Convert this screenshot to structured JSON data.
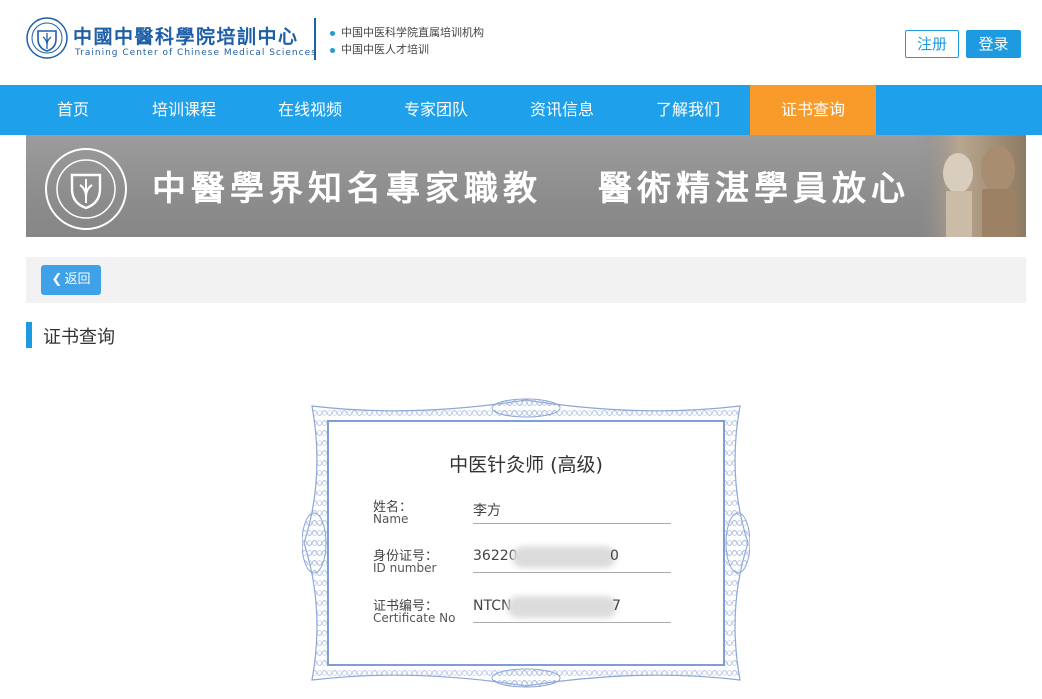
{
  "header": {
    "brand_cn": "中國中醫科學院培訓中心",
    "brand_en": "Training Center of Chinese Medical Sciences",
    "bullets": [
      "中国中医科学院直属培训机构",
      "中国中医人才培训"
    ],
    "register_label": "注册",
    "login_label": "登录"
  },
  "nav": {
    "items": [
      {
        "label": "首页",
        "active": false
      },
      {
        "label": "培训课程",
        "active": false
      },
      {
        "label": "在线视频",
        "active": false
      },
      {
        "label": "专家团队",
        "active": false
      },
      {
        "label": "资讯信息",
        "active": false
      },
      {
        "label": "了解我们",
        "active": false
      },
      {
        "label": "证书查询",
        "active": true
      }
    ]
  },
  "banner": {
    "text1": "中醫學界知名專家職教",
    "text2": "醫術精湛學員放心"
  },
  "back_label": "返回",
  "section_title": "证书查询",
  "certificate": {
    "title": "中医针灸师 (高级)",
    "fields": [
      {
        "label_cn": "姓名：",
        "label_en": "Name",
        "value": "李方"
      },
      {
        "label_cn": "身份证号：",
        "label_en": "ID number",
        "value": "36220",
        "value_tail": "0"
      },
      {
        "label_cn": "证书编号：",
        "label_en": "Certificate No",
        "value": "NTCN",
        "value_tail": "7"
      }
    ]
  },
  "colors": {
    "primary": "#1ea0ea",
    "active_nav": "#f99b2b",
    "brand": "#1f5fa8",
    "cert_border": "#7f9ed4"
  }
}
